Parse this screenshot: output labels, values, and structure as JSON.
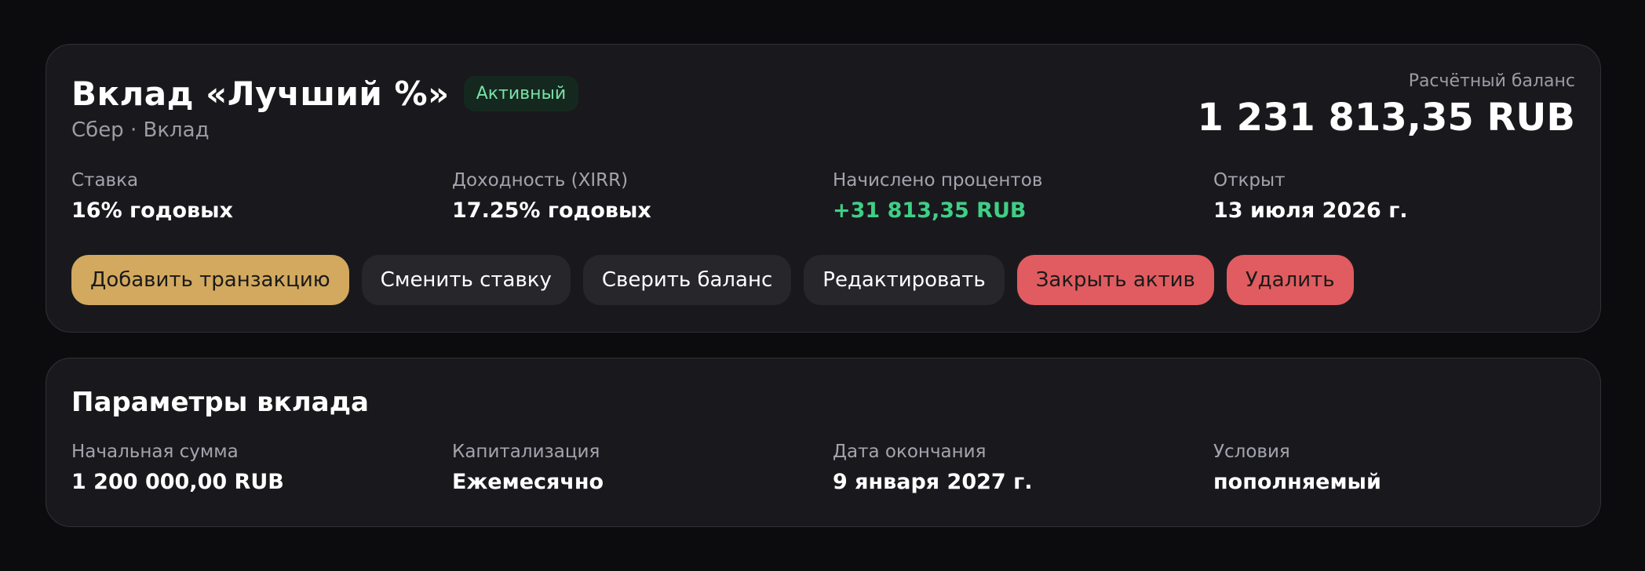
{
  "header": {
    "title": "Вклад «Лучший %»",
    "status": "Активный",
    "subtitle": "Сбер · Вклад",
    "balance_label": "Расчётный баланс",
    "balance_value": "1 231 813,35 RUB"
  },
  "metrics": [
    {
      "label": "Ставка",
      "value": "16% годовых"
    },
    {
      "label": "Доходность (XIRR)",
      "value": "17.25% годовых"
    },
    {
      "label": "Начислено процентов",
      "value": "+31 813,35 RUB"
    },
    {
      "label": "Открыт",
      "value": "13 июля 2026 г."
    }
  ],
  "actions": {
    "add_transaction": "Добавить транзакцию",
    "change_rate": "Сменить ставку",
    "reconcile_balance": "Сверить баланс",
    "edit": "Редактировать",
    "close_asset": "Закрыть актив",
    "delete": "Удалить"
  },
  "params": {
    "title": "Параметры вклада",
    "items": [
      {
        "label": "Начальная сумма",
        "value": "1 200 000,00 RUB"
      },
      {
        "label": "Капитализация",
        "value": "Ежемесячно"
      },
      {
        "label": "Дата окончания",
        "value": "9 января 2027 г."
      },
      {
        "label": "Условия",
        "value": "пополняемый"
      }
    ]
  },
  "colors": {
    "background": "#0c0c0e",
    "card": "#19191d",
    "accent_gold": "#d2a95e",
    "danger": "#e05c60",
    "positive": "#3fcf86",
    "badge_text": "#7be0a8"
  }
}
